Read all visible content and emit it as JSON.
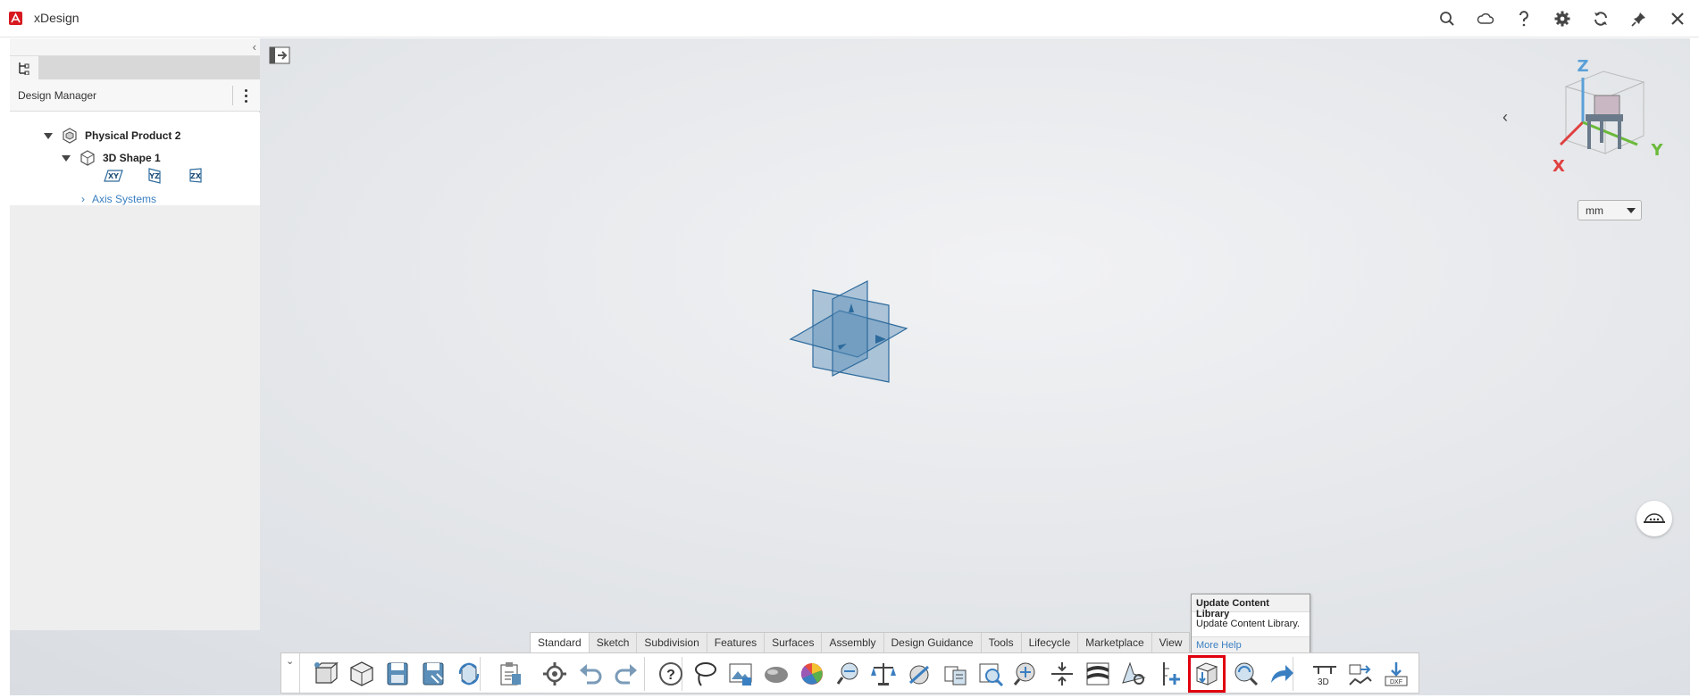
{
  "app": {
    "title": "xDesign"
  },
  "titlebar_icons": [
    "search-icon",
    "cloud-icon",
    "help-icon",
    "settings-icon",
    "refresh-icon",
    "pin-icon",
    "close-icon"
  ],
  "left_panel": {
    "header_label": "Design Manager",
    "tree": {
      "product": "Physical Product 2",
      "shape": "3D Shape 1",
      "planes": [
        "XY",
        "YZ",
        "ZX"
      ],
      "axis_systems": "Axis Systems"
    }
  },
  "compass": {
    "z": "Z",
    "x": "X",
    "y": "Y"
  },
  "unit": {
    "selected": "mm"
  },
  "action_tabs": [
    "Standard",
    "Sketch",
    "Subdivision",
    "Features",
    "Surfaces",
    "Assembly",
    "Design Guidance",
    "Tools",
    "Lifecycle",
    "Marketplace",
    "View"
  ],
  "active_tab": "Standard",
  "tools": [
    "new-3d-shape-icon",
    "new-physical-product-icon",
    "save-icon",
    "save-as-icon",
    "sync-icon",
    "clipboard-icon",
    "options-icon",
    "undo-icon",
    "redo-icon",
    "help-icon",
    "lasso-icon",
    "image-icon",
    "shading-icon",
    "color-wheel-icon",
    "measure-icon",
    "balance-icon",
    "section-icon",
    "bom-icon",
    "inspect-icon",
    "compare-icon",
    "align-icon",
    "zebra-icon",
    "snapshot-icon",
    "axis-add-icon",
    "update-content-library-icon",
    "explore-icon",
    "share-icon",
    "drawing-icon",
    "export-step-icon",
    "export-dxf-icon"
  ],
  "tooltip": {
    "title": "Update Content Library",
    "description": "Update Content Library.",
    "help": "More Help"
  },
  "colors": {
    "accent_red": "#e0000f",
    "link_blue": "#3a7fc1",
    "plane_blue": "#5b8fb9"
  }
}
